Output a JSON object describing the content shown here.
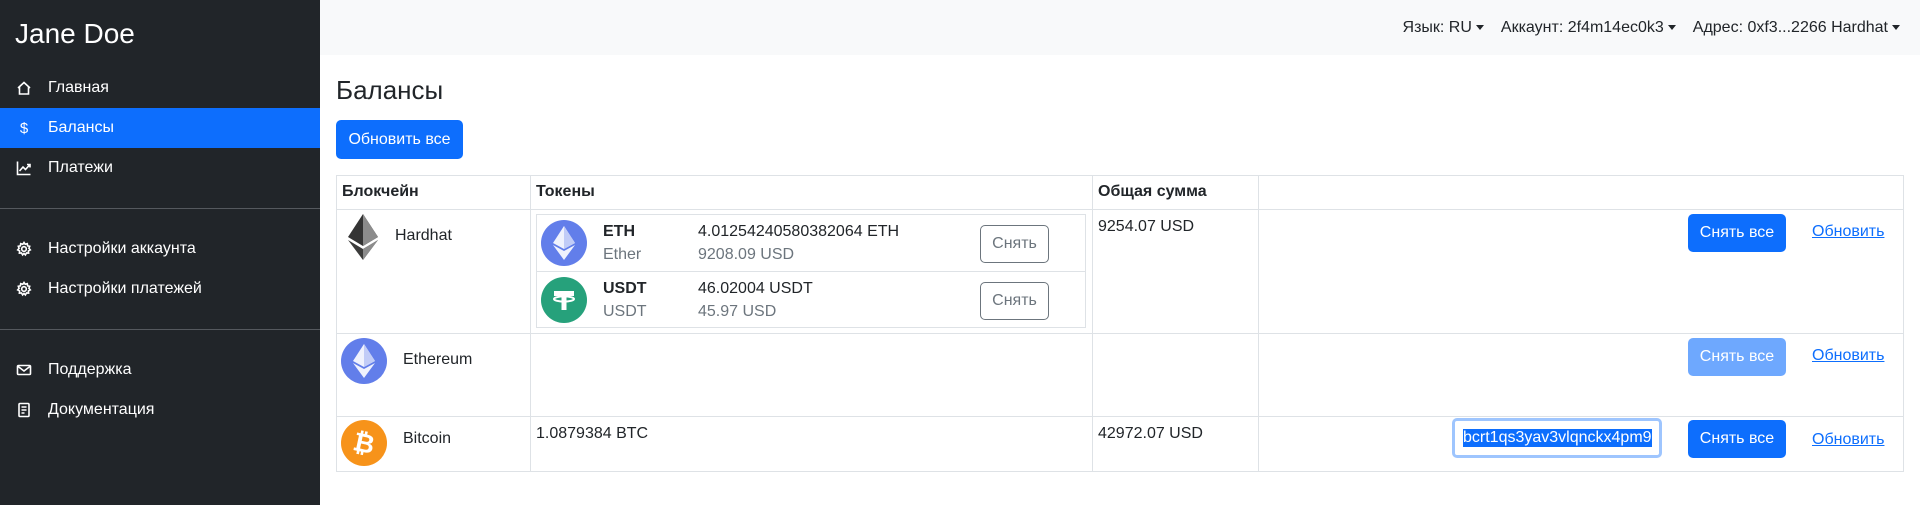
{
  "sidebar": {
    "brand": "Jane Doe",
    "items": [
      {
        "label": "Главная",
        "icon": "house-icon"
      },
      {
        "label": "Балансы",
        "icon": "dollar-icon",
        "active": true
      },
      {
        "label": "Платежи",
        "icon": "chart-line-icon"
      },
      {
        "label": "Настройки аккаунта",
        "icon": "gear-icon"
      },
      {
        "label": "Настройки платежей",
        "icon": "gear-icon"
      },
      {
        "label": "Поддержка",
        "icon": "envelope-icon"
      },
      {
        "label": "Документация",
        "icon": "document-icon"
      }
    ],
    "dollar_glyph": "$"
  },
  "topbar": {
    "language": "Язык: RU",
    "account": "Аккаунт: 2f4m14ec0k3",
    "address": "Адрес: 0xf3...2266 Hardhat"
  },
  "main": {
    "title": "Балансы",
    "refresh_all_label": "Обновить все",
    "table": {
      "headers": [
        "Блокчейн",
        "Токены",
        "Общая сумма",
        ""
      ],
      "rows": [
        {
          "chain": "Hardhat",
          "icon": "ethereum-diamond-icon",
          "tokens": [
            {
              "symbol": "ETH",
              "name": "Ether",
              "amount": "4.01254240580382064 ETH",
              "usd": "9208.09 USD",
              "withdraw_label": "Снять",
              "icon": "eth-coin-icon"
            },
            {
              "symbol": "USDT",
              "name": "USDT",
              "amount": "46.02004 USDT",
              "usd": "45.97 USD",
              "withdraw_label": "Снять",
              "icon": "tether-coin-icon"
            }
          ],
          "total": "9254.07 USD",
          "withdraw_all_label": "Снять все",
          "update_label": "Обновить"
        },
        {
          "chain": "Ethereum",
          "icon": "eth-coin-icon",
          "total": "",
          "withdraw_all_label": "Снять все",
          "withdraw_all_disabled": true,
          "update_label": "Обновить"
        },
        {
          "chain": "Bitcoin",
          "icon": "bitcoin-coin-icon",
          "tokens_text": "1.0879384 BTC",
          "total": "42972.07 USD",
          "address_input_value": "bcrt1qs3yav3vlqnckx4pm9",
          "withdraw_all_label": "Снять все",
          "update_label": "Обновить"
        }
      ]
    }
  },
  "colors": {
    "sidebar_bg": "#212529",
    "primary": "#0d6efd",
    "topbar_bg": "#f8f9fa",
    "eth": "#627eea",
    "usdt": "#26a17b",
    "btc": "#f7931a"
  }
}
